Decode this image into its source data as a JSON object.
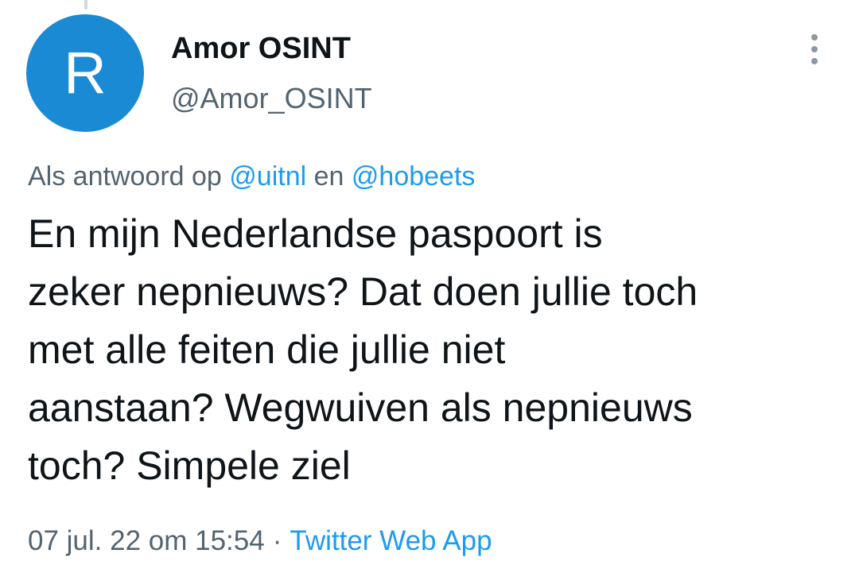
{
  "tweet": {
    "avatar_initial": "R",
    "author": {
      "display_name": "Amor OSINT",
      "handle": "@Amor_OSINT"
    },
    "reply_to": {
      "prefix": "Als antwoord op",
      "mentions": [
        "@uitnl",
        "@hobeets"
      ],
      "joiner": "en"
    },
    "text_lines": [
      "En mijn Nederlandse paspoort is",
      "zeker nepnieuws? Dat doen jullie toch",
      "met alle feiten die jullie niet",
      "aanstaan? Wegwuiven als nepnieuws",
      "toch? Simpele ziel"
    ],
    "timestamp": "07 jul. 22 om 15:54",
    "separator": "·",
    "source": "Twitter Web App"
  },
  "icons": {
    "more": "more-vertical-icon"
  },
  "colors": {
    "avatar_bg": "#1a8ad4",
    "link": "#1d9bf0",
    "secondary_text": "#536471",
    "primary_text": "#0f1419"
  }
}
